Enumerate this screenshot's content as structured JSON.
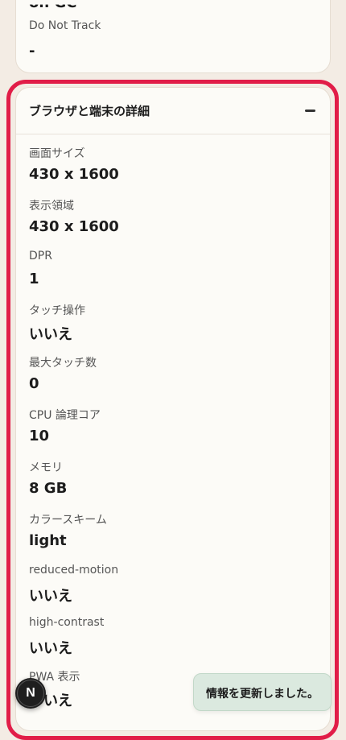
{
  "top_card": {
    "cut_value": "on GC",
    "label": "Do Not Track",
    "value": "-"
  },
  "section": {
    "title": "ブラウザと端末の詳細",
    "rows": [
      {
        "label": "画面サイズ",
        "value": "430 x 1600"
      },
      {
        "label": "表示領域",
        "value": "430 x 1600"
      },
      {
        "label": "DPR",
        "value": "1"
      },
      {
        "label": "タッチ操作",
        "value": "いいえ"
      },
      {
        "label": "最大タッチ数",
        "value": "0"
      },
      {
        "label": "CPU 論理コア",
        "value": "10"
      },
      {
        "label": "メモリ",
        "value": "8 GB"
      },
      {
        "label": "カラースキーム",
        "value": "light"
      },
      {
        "label": "reduced-motion",
        "value": "いいえ"
      },
      {
        "label": "high-contrast",
        "value": "いいえ"
      },
      {
        "label": "PWA 表示",
        "value": "いいえ"
      }
    ]
  },
  "avatar": {
    "letter": "N"
  },
  "toast": {
    "message": "情報を更新しました。"
  },
  "colors": {
    "highlight": "#e11d48",
    "toast_bg": "#dbe9df",
    "page_bg": "#f3ece4"
  }
}
